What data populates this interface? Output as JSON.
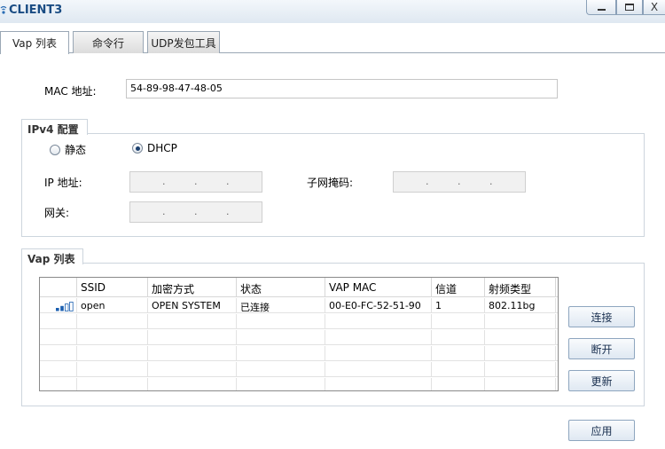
{
  "window": {
    "title": "CLIENT3",
    "close_glyph": "X",
    "icons": {
      "app": "client-app-icon",
      "minimize": "minimize-icon",
      "maximize": "maximize-icon",
      "close": "close-icon"
    }
  },
  "tabs": [
    {
      "label": "Vap 列表",
      "active": true
    },
    {
      "label": "命令行",
      "active": false
    },
    {
      "label": "UDP发包工具",
      "active": false
    }
  ],
  "mac": {
    "label": "MAC 地址:",
    "value": "54-89-98-47-48-05"
  },
  "ipv4": {
    "legend": "IPv4 配置",
    "static_label": "静态",
    "dhcp_label": "DHCP",
    "selected": "DHCP",
    "ip_label": "IP 地址:",
    "mask_label": "子网掩码:",
    "gateway_label": "网关:",
    "ip_dot": "."
  },
  "vap": {
    "legend": "Vap 列表",
    "columns": [
      "SSID",
      "加密方式",
      "状态",
      "VAP MAC",
      "信道",
      "射频类型"
    ],
    "rows": [
      {
        "signal_icon": "signal-strength-icon",
        "signal_bars_filled": 2,
        "signal_bars_total": 4,
        "ssid": "open",
        "encryption": "OPEN SYSTEM",
        "status": "已连接",
        "vap_mac": "00-E0-FC-52-51-90",
        "channel": "1",
        "radio_type": "802.11bg"
      }
    ],
    "buttons": {
      "connect": "连接",
      "disconnect": "断开",
      "refresh": "更新"
    }
  },
  "apply_label": "应用",
  "colors": {
    "title": "#1a4c83",
    "signal_on": "#1b5fb0",
    "signal_off": "#1b5fb0"
  }
}
